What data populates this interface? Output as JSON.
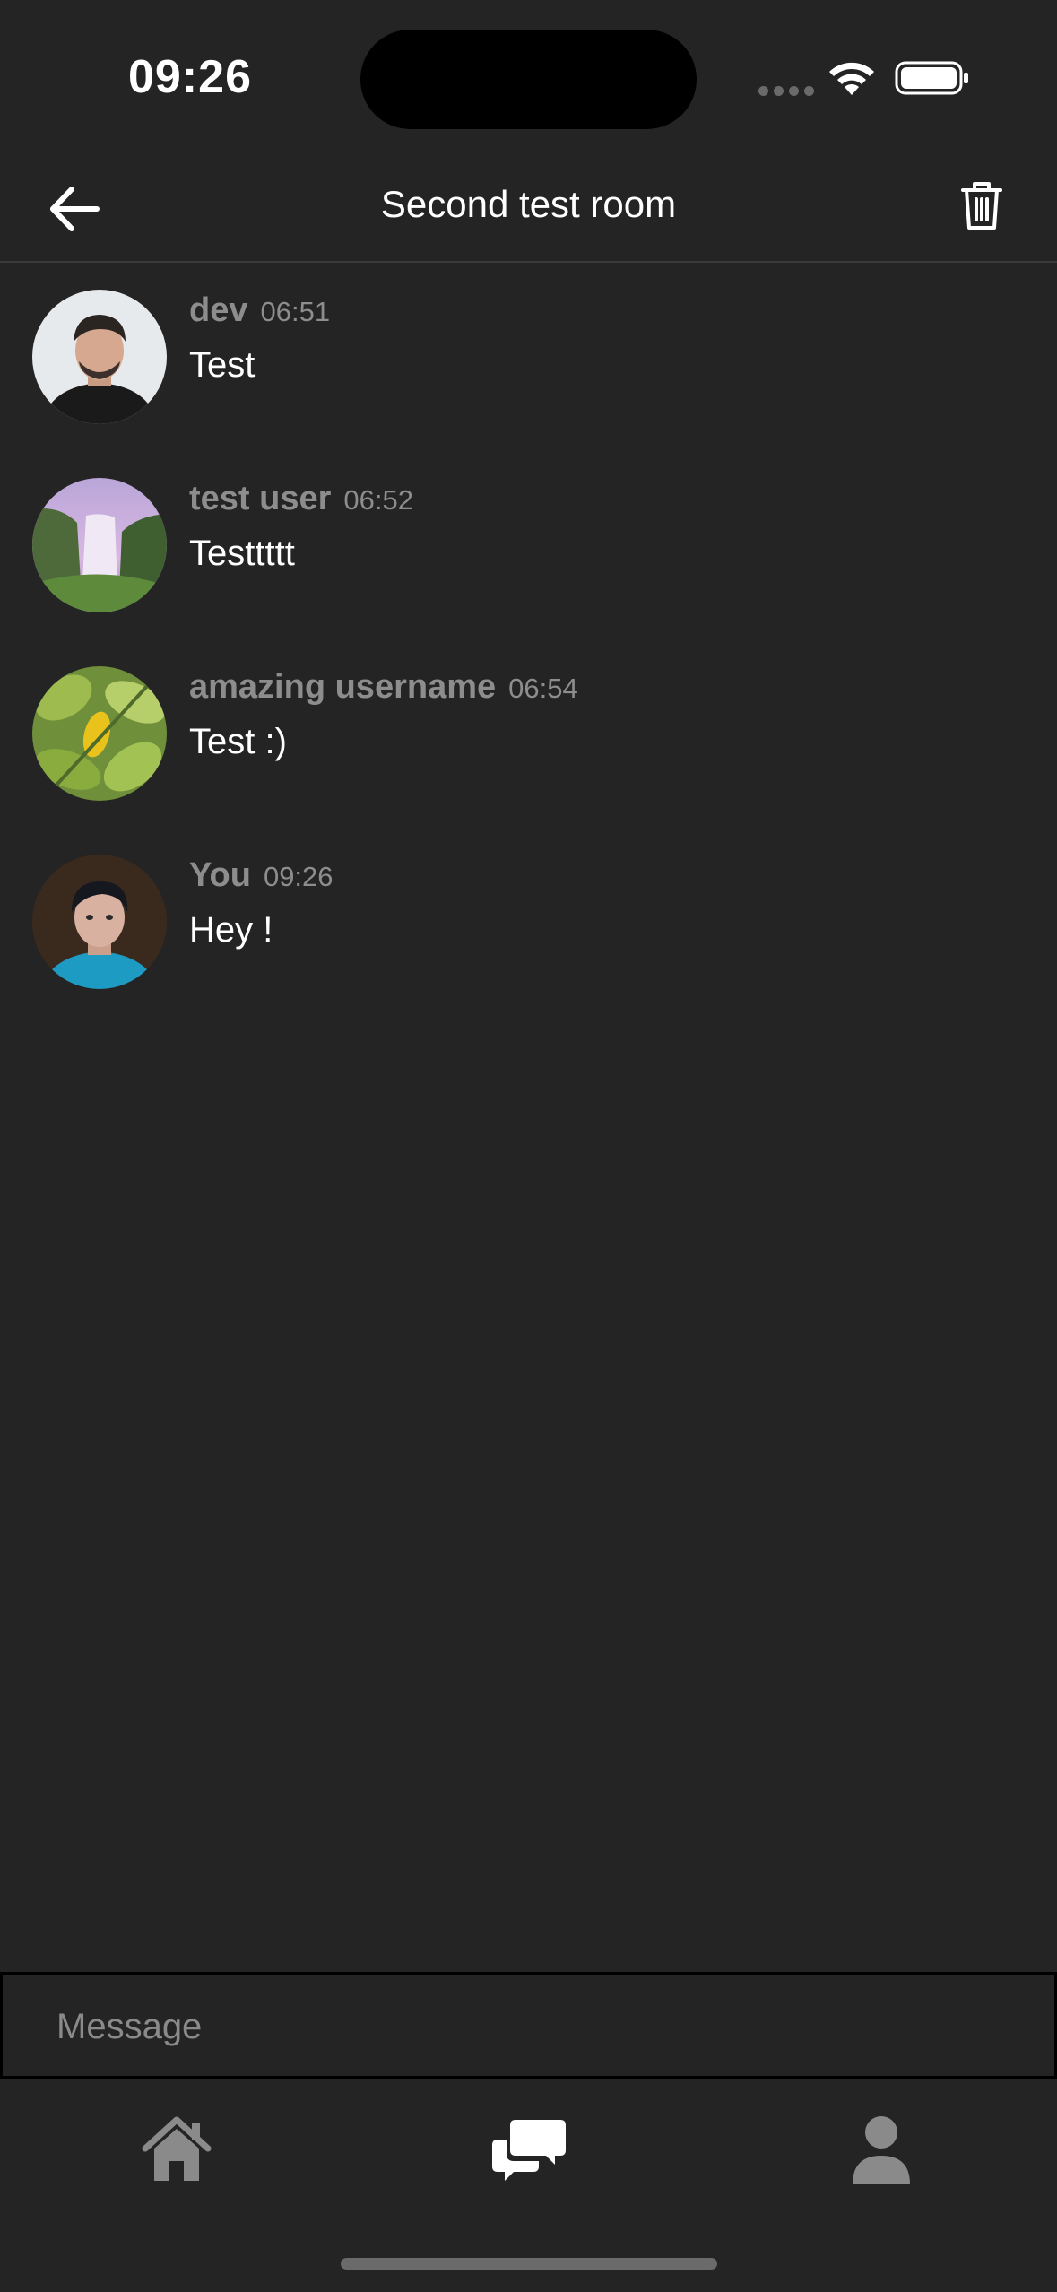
{
  "status_bar": {
    "time": "09:26",
    "wifi_icon": "wifi-icon",
    "battery_icon": "battery-icon"
  },
  "header": {
    "title": "Second test room",
    "back_icon": "arrow-left-icon",
    "delete_icon": "trash-icon"
  },
  "messages": [
    {
      "user": "dev",
      "time": "06:51",
      "text": "Test"
    },
    {
      "user": "test user",
      "time": "06:52",
      "text": "Testtttt"
    },
    {
      "user": "amazing username",
      "time": "06:54",
      "text": "Test :)"
    },
    {
      "user": "You",
      "time": "09:26",
      "text": "Hey !"
    }
  ],
  "composer": {
    "placeholder": "Message",
    "value": ""
  },
  "tab_bar": {
    "tabs": [
      {
        "icon": "home-icon",
        "active": false
      },
      {
        "icon": "chat-bubbles-icon",
        "active": true
      },
      {
        "icon": "person-icon",
        "active": false
      }
    ]
  },
  "colors": {
    "background": "#242424",
    "meta_text": "#8d8d8d",
    "inactive_icon": "#8a8a8a",
    "active_icon": "#ffffff"
  }
}
